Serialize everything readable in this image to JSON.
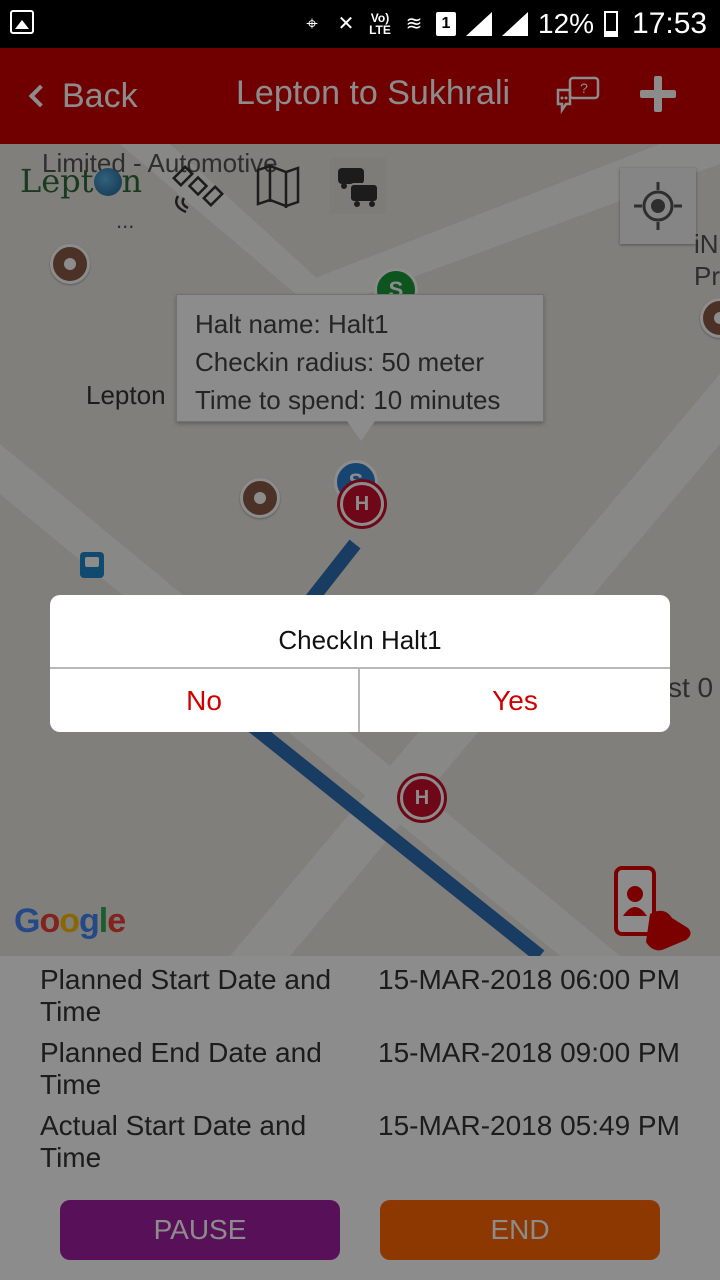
{
  "status_bar": {
    "network": "Vo) LTE",
    "sim_slot": "1",
    "battery": "12%",
    "time": "17:53"
  },
  "header": {
    "back_label": "Back",
    "title": "Lepton to Sukhrali",
    "color": "#cc0000"
  },
  "map": {
    "brand_label": "Limited - Automotive",
    "logo_text": [
      "Lept",
      "n"
    ],
    "dots": "...",
    "place_label": "Lepton",
    "right_label": "iN\nPr",
    "right_label_2": "st 0",
    "google": [
      "G",
      "o",
      "o",
      "g",
      "l",
      "e"
    ],
    "info_window": {
      "lines": [
        "Halt name: Halt1",
        "Checkin radius: 50 meter",
        "Time to spend: 10 minutes"
      ]
    },
    "start_marker_text": "S",
    "halt_marker_text": "H"
  },
  "dialog": {
    "title": "CheckIn Halt1",
    "no_label": "No",
    "yes_label": "Yes"
  },
  "details": {
    "rows": [
      {
        "label": "Planned Start Date and Time",
        "value": "15-MAR-2018 06:00 PM"
      },
      {
        "label": "Planned End Date and Time",
        "value": "15-MAR-2018 09:00 PM"
      },
      {
        "label": "Actual Start Date and Time",
        "value": "15-MAR-2018 05:49 PM"
      }
    ],
    "pause_label": "PAUSE",
    "end_label": "END"
  },
  "colors": {
    "accent_red": "#cc0000",
    "pause": "#a01ea0",
    "end": "#ff6600",
    "route": "#1e6ec8"
  }
}
